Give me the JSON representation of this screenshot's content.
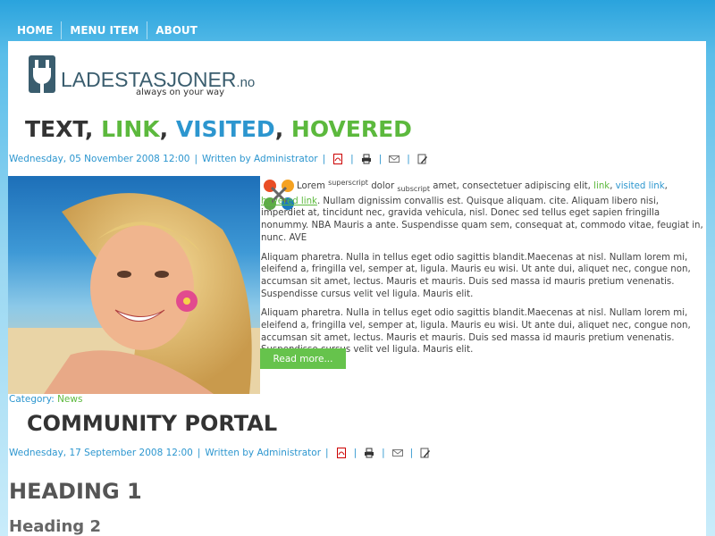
{
  "nav": {
    "items": [
      "HOME",
      "MENU ITEM",
      "ABOUT"
    ]
  },
  "logo": {
    "text": "LADESTASJONER",
    "tld": ".no",
    "tagline": "always on your way"
  },
  "article1": {
    "title_parts": [
      "TEXT",
      ", ",
      "LINK",
      ", ",
      "VISITED",
      ", ",
      "HOVERED"
    ],
    "meta_date": "Wednesday, 05 November 2008 12:00",
    "meta_author": "Written by Administrator",
    "p1": {
      "lorem": "Lorem ",
      "sup": "superscript",
      "dolor": " dolor ",
      "sub": "subscript",
      "rest": " amet, consectetuer adipiscing elit, ",
      "link": "link",
      "comma1": ", ",
      "visited": "visited link",
      "comma2": ", ",
      "hovered": "hovered link",
      "tail": ". Nullam dignissim convallis est. Quisque aliquam. cite. Aliquam libero nisi, imperdiet at, tincidunt nec, gravida vehicula, nisl. Donec sed tellus eget sapien fringilla nonummy. NBA Mauris a ante. Suspendisse quam sem, consequat at, commodo vitae, feugiat in, nunc. AVE"
    },
    "p2": "Aliquam pharetra. Nulla in tellus eget odio sagittis blandit.Maecenas at nisl. Nullam lorem mi, eleifend a, fringilla vel, semper at, ligula. Mauris eu wisi. Ut ante dui, aliquet nec, congue non, accumsan sit amet, lectus. Mauris et mauris. Duis sed massa id mauris pretium venenatis. Suspendisse cursus velit vel ligula. Mauris elit.",
    "p3": "Aliquam pharetra. Nulla in tellus eget odio sagittis blandit.Maecenas at nisl. Nullam lorem mi, eleifend a, fringilla vel, semper at, ligula. Mauris eu wisi. Ut ante dui, aliquet nec, congue non, accumsan sit amet, lectus. Mauris et mauris. Duis sed massa id mauris pretium venenatis. Suspendisse cursus velit vel ligula. Mauris elit.",
    "read_more": "Read more...",
    "category_label": "Category: ",
    "category_value": "News"
  },
  "article2": {
    "title": "COMMUNITY PORTAL",
    "meta_date": "Wednesday, 17 September 2008 12:00",
    "meta_author": "Written by Administrator",
    "heading1": "HEADING 1",
    "heading2": "Heading 2"
  },
  "icons": [
    "pdf-icon",
    "print-icon",
    "email-icon",
    "edit-icon"
  ],
  "colors": {
    "accent_blue": "#2c96cf",
    "accent_green": "#5cb93d",
    "button_green": "#66c34c"
  }
}
